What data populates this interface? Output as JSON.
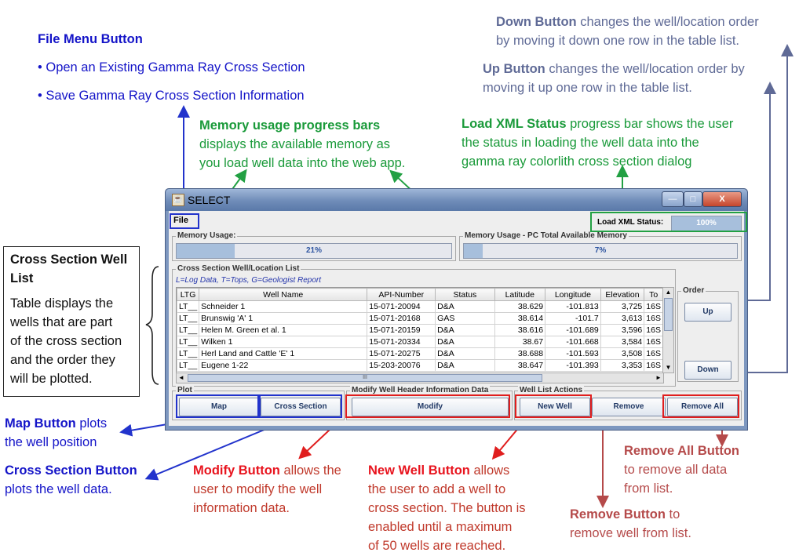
{
  "annotations": {
    "file_menu": {
      "title": "File Menu Button",
      "bullet1": "• Open an Existing Gamma Ray Cross Section",
      "bullet2": "• Save Gamma Ray Cross Section Information"
    },
    "memory": {
      "title": "Memory usage progress bars",
      "line1": "displays the available memory as",
      "line2": "you load well data into the web app."
    },
    "load_xml": {
      "title": "Load XML Status",
      "line1": " progress bar shows the user",
      "line2": "the status in loading the well data into the",
      "line3": "gamma ray colorlith cross section dialog"
    },
    "down": {
      "title": "Down Button",
      "line1": " changes the well/location order",
      "line2": "by moving it down one row in the table list."
    },
    "up": {
      "title": "Up Button",
      "line1": " changes the well/location order by",
      "line2": "moving it up one row in the table list."
    },
    "well_list": {
      "title1": "Cross Section Well",
      "title2": "List",
      "body1": "Table displays the",
      "body2": "wells that are part",
      "body3": "of the cross section",
      "body4": "and the order they",
      "body5": "will be plotted."
    },
    "map": {
      "title": "Map Button",
      "line1": " plots",
      "line2": "the well position"
    },
    "cross_section": {
      "title": "Cross Section Button",
      "line1": "plots the  well data."
    },
    "modify": {
      "title": "Modify Button",
      "line1": " allows the",
      "line2": "user to modify the well",
      "line3": "information data."
    },
    "new_well": {
      "title": "New Well Button",
      "line1": " allows",
      "line2": "the user to add a well to",
      "line3": "cross section.  The button is",
      "line4": "enabled until a maximum",
      "line5": "of 50 wells are reached."
    },
    "remove_all": {
      "title": "Remove All Button",
      "line1": "to remove all data",
      "line2": "from list."
    },
    "remove": {
      "title": "Remove Button",
      "line1": " to",
      "line2": "remove well  from list."
    }
  },
  "window": {
    "title": "SELECT",
    "min_glyph": "—",
    "max_glyph": "□",
    "close_glyph": "X",
    "menu_file": "File",
    "load_xml_label": "Load XML Status:",
    "load_xml_value": "100%",
    "load_xml_fraction": 1.0,
    "memory_label": "Memory Usage:",
    "memory_value": "21%",
    "memory_fraction": 0.21,
    "pc_memory_label": "Memory Usage - PC Total Available Memory",
    "pc_memory_value": "7%",
    "pc_memory_fraction": 0.07,
    "well_list_label": "Cross Section Well/Location List",
    "legend": "L=Log Data, T=Tops, G=Geologist Report",
    "columns": [
      "LTG",
      "Well Name",
      "API-Number",
      "Status",
      "Latitude",
      "Longitude",
      "Elevation",
      "To"
    ],
    "rows": [
      [
        "LT__",
        "Schneider 1",
        "15-071-20094",
        "D&A",
        "38.629",
        "-101.813",
        "3,725",
        "16S"
      ],
      [
        "LT__",
        "Brunswig 'A' 1",
        "15-071-20168",
        "GAS",
        "38.614",
        "-101.7",
        "3,613",
        "16S"
      ],
      [
        "LT__",
        "Helen M. Green et al. 1",
        "15-071-20159",
        "D&A",
        "38.616",
        "-101.689",
        "3,596",
        "16S"
      ],
      [
        "LT__",
        "Wilken 1",
        "15-071-20334",
        "D&A",
        "38.67",
        "-101.668",
        "3,584",
        "16S"
      ],
      [
        "LT__",
        "Herl Land and Cattle 'E' 1",
        "15-071-20275",
        "D&A",
        "38.688",
        "-101.593",
        "3,508",
        "16S"
      ],
      [
        "LT__",
        "Eugene 1-22",
        "15-203-20076",
        "D&A",
        "38.647",
        "-101.393",
        "3,353",
        "16S"
      ]
    ],
    "order_label": "Order",
    "up_label": "Up",
    "down_label": "Down",
    "plot_label": "Plot",
    "map_label": "Map",
    "cross_section_label": "Cross Section",
    "modify_group_label": "Modify Well Header Information Data",
    "modify_label": "Modify",
    "actions_label": "Well List Actions",
    "new_well_label": "New Well",
    "remove_label": "Remove",
    "remove_all_label": "Remove All",
    "scroll_up": "▲",
    "scroll_down": "▼",
    "scroll_left": "◄",
    "scroll_right": "►",
    "scroll_grip": "III"
  },
  "colors": {
    "blue": "#1414c8",
    "green": "#1a9a3a",
    "slate": "#5f6a96",
    "red": "#e8141e",
    "rose": "#b54a4a"
  }
}
